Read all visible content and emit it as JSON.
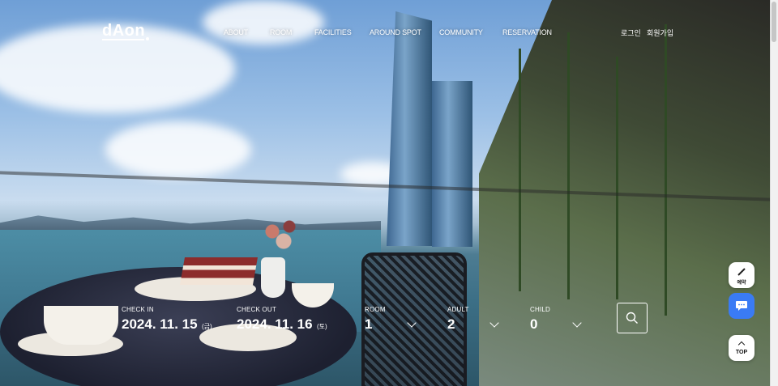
{
  "header": {
    "logo": "dAon",
    "nav": [
      "ABOUT",
      "ROOM",
      "FACILITIES",
      "AROUND SPOT",
      "COMMUNITY",
      "RESERVATION"
    ],
    "login": "로그인",
    "signup": "회원가입"
  },
  "booking": {
    "check_in": {
      "label": "CHECK IN",
      "date": "2024. 11. 15",
      "day": "(금)"
    },
    "check_out": {
      "label": "CHECK OUT",
      "date": "2024. 11. 16",
      "day": "(토)"
    },
    "room": {
      "label": "ROOM",
      "value": "1"
    },
    "adult": {
      "label": "ADULT",
      "value": "2"
    },
    "child": {
      "label": "CHILD",
      "value": "0"
    }
  },
  "floating": {
    "top_label": "TOP",
    "app_label": "예약"
  },
  "colors": {
    "chat_button": "#3a7bf4",
    "text": "#ffffff"
  }
}
